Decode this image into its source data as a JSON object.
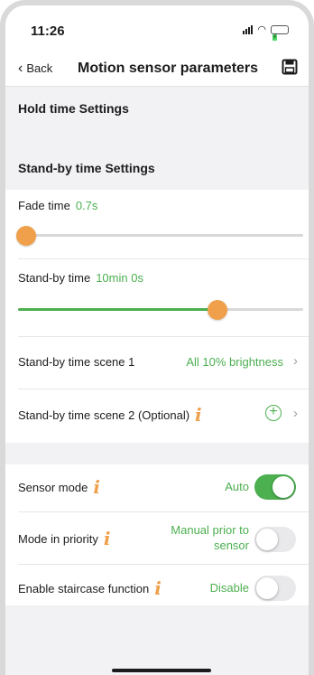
{
  "status": {
    "time": "11:26",
    "battery_glyph": "⚡"
  },
  "nav": {
    "back_label": "Back",
    "title": "Motion sensor parameters",
    "save_icon": "save-icon"
  },
  "sections": {
    "hold_time": "Hold time Settings",
    "standby": "Stand-by time Settings"
  },
  "fade_time": {
    "label": "Fade time",
    "value": "0.7s",
    "level": 0.03
  },
  "standby_time": {
    "label": "Stand-by time",
    "value": "10min 0s",
    "level": 0.7
  },
  "scene1": {
    "label": "Stand-by time scene 1",
    "value": "All 10% brightness"
  },
  "scene2": {
    "label": "Stand-by time scene 2 (Optional)"
  },
  "info_glyph": "i",
  "add_glyph": "+",
  "chevron_glyph": "›",
  "sensor_mode": {
    "label": "Sensor mode",
    "value": "Auto",
    "on": true
  },
  "mode_priority": {
    "label": "Mode in priority",
    "value_line1": "Manual prior to",
    "value_line2": "sensor",
    "on": false
  },
  "staircase": {
    "label": "Enable staircase function",
    "value": "Disable",
    "on": false
  },
  "colors": {
    "accent": "#4caf50",
    "thumb": "#f0a04b",
    "section_bg": "#f2f2f4"
  }
}
